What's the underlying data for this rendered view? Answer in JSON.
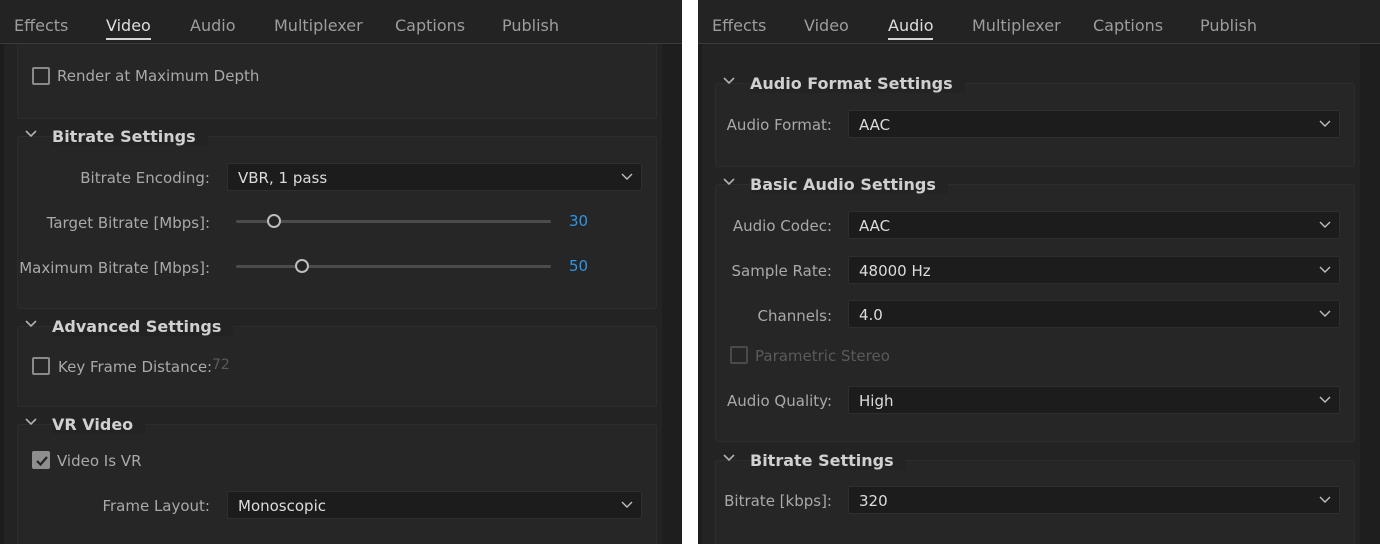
{
  "left": {
    "tabs": [
      "Effects",
      "Video",
      "Audio",
      "Multiplexer",
      "Captions",
      "Publish"
    ],
    "active_tab": "Video",
    "render_max_depth": {
      "label": "Render at Maximum Depth",
      "checked": false
    },
    "bitrate_settings": {
      "title": "Bitrate Settings",
      "encoding_label": "Bitrate Encoding:",
      "encoding_value": "VBR, 1 pass",
      "target_label": "Target Bitrate [Mbps]:",
      "target_value": "30",
      "target_level": 0.12,
      "max_label": "Maximum Bitrate [Mbps]:",
      "max_value": "50",
      "max_level": 0.21
    },
    "advanced_settings": {
      "title": "Advanced Settings",
      "keyframe_label": "Key Frame Distance:",
      "keyframe_value": "72",
      "keyframe_checked": false
    },
    "vr_video": {
      "title": "VR Video",
      "is_vr_label": "Video Is VR",
      "is_vr_checked": true,
      "frame_layout_label": "Frame Layout:",
      "frame_layout_value": "Monoscopic"
    }
  },
  "right": {
    "tabs": [
      "Effects",
      "Video",
      "Audio",
      "Multiplexer",
      "Captions",
      "Publish"
    ],
    "active_tab": "Audio",
    "audio_format_settings": {
      "title": "Audio Format Settings",
      "format_label": "Audio Format:",
      "format_value": "AAC"
    },
    "basic_audio_settings": {
      "title": "Basic Audio Settings",
      "codec_label": "Audio Codec:",
      "codec_value": "AAC",
      "sample_rate_label": "Sample Rate:",
      "sample_rate_value": "48000 Hz",
      "channels_label": "Channels:",
      "channels_value": "4.0",
      "parametric_label": "Parametric Stereo",
      "quality_label": "Audio Quality:",
      "quality_value": "High"
    },
    "bitrate_settings": {
      "title": "Bitrate Settings",
      "bitrate_label": "Bitrate [kbps]:",
      "bitrate_value": "320"
    }
  },
  "colors": {
    "accent": "#2f95e6",
    "panel_bg": "#232323",
    "field_bg": "#1c1c1c"
  },
  "icons": {
    "collapse": "chevron-down-icon",
    "dropdown": "dropdown-arrow-icon",
    "check": "checkmark-icon"
  }
}
